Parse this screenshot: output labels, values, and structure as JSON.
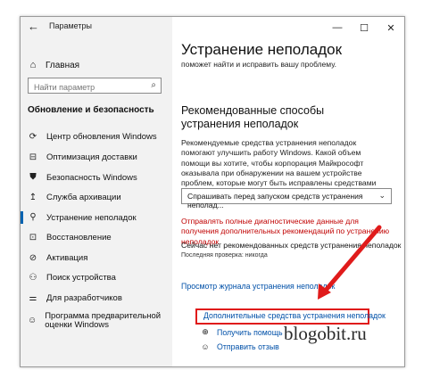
{
  "window": {
    "title": "Параметры",
    "minimize_icon": "minimize-icon",
    "maximize_icon": "maximize-icon",
    "close_icon": "close-icon"
  },
  "sidebar": {
    "home_label": "Главная",
    "search_placeholder": "Найти параметр",
    "section_title": "Обновление и безопасность",
    "items": [
      {
        "label": "Центр обновления Windows",
        "icon": "sync-icon"
      },
      {
        "label": "Оптимизация доставки",
        "icon": "delivery-icon"
      },
      {
        "label": "Безопасность Windows",
        "icon": "shield-icon"
      },
      {
        "label": "Служба архивации",
        "icon": "backup-icon"
      },
      {
        "label": "Устранение неполадок",
        "icon": "wrench-icon",
        "active": true
      },
      {
        "label": "Восстановление",
        "icon": "recovery-icon"
      },
      {
        "label": "Активация",
        "icon": "activation-icon"
      },
      {
        "label": "Поиск устройства",
        "icon": "find-device-icon"
      },
      {
        "label": "Для разработчиков",
        "icon": "developer-icon"
      },
      {
        "label": "Программа предварительной оценки Windows",
        "icon": "insider-icon"
      }
    ]
  },
  "main": {
    "title": "Устранение неполадок",
    "cut_text": "поможет найти и исправить вашу проблему.",
    "recommended_heading": "Рекомендованные способы устранения неполадок",
    "recommended_desc": "Рекомендуемые средства устранения неполадок помогают улучшить работу Windows. Какой объем помощи вы хотите, чтобы корпорация Майкрософт оказывала при обнаружении на вашем устройстве проблем, которые могут быть исправлены средствами устранения неполадок?",
    "dropdown_value": "Спрашивать перед запуском средств устранения неполадок",
    "dropdown_visible": "Спрашивать перед запуском средств устранения неполад...",
    "diagnostic_link": "Отправлять полные диагностические данные для получения дополнительных рекомендаций по устранению неполадок",
    "status_text": "Сейчас нет рекомендованных средств устранения неполадок",
    "last_check": "Последняя проверка: никогда",
    "history_link": "Просмотр журнала устранения неполадок",
    "additional_link": "Дополнительные средства устранения неполадок",
    "get_help": "Получить помощь",
    "feedback": "Отправить отзыв"
  },
  "watermark": "blogobit.ru",
  "colors": {
    "accent": "#0063b1",
    "link": "#0050a8",
    "warning_red": "#c00000",
    "highlight": "#e01b1b"
  }
}
